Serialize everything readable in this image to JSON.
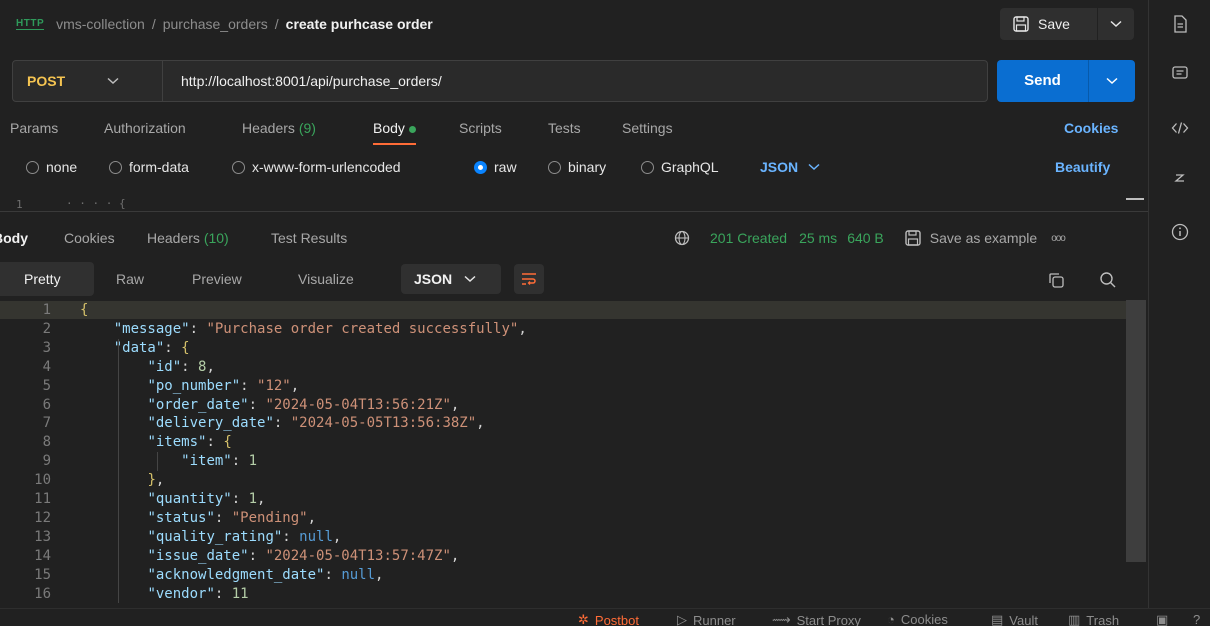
{
  "breadcrumb": {
    "badge": "HTTP",
    "collection": "vms-collection",
    "folder": "purchase_orders",
    "request": "create purhcase order",
    "sep": "/"
  },
  "save": {
    "label": "Save"
  },
  "request": {
    "method": "POST",
    "url": "http://localhost:8001/api/purchase_orders/",
    "send_label": "Send"
  },
  "req_tabs": [
    {
      "label": "Params"
    },
    {
      "label": "Authorization"
    },
    {
      "label": "Headers",
      "count": "(9)"
    },
    {
      "label": "Body",
      "active": true
    },
    {
      "label": "Scripts"
    },
    {
      "label": "Tests"
    },
    {
      "label": "Settings"
    }
  ],
  "cookies_link": "Cookies",
  "body_types": [
    "none",
    "form-data",
    "x-www-form-urlencoded",
    "raw",
    "binary",
    "GraphQL"
  ],
  "body_type_selected": "raw",
  "body_lang": "JSON",
  "beautify_label": "Beautify",
  "req_editor": {
    "line": "1",
    "text": "· · · · {"
  },
  "resp_tabs": [
    {
      "label": "Body",
      "active": true
    },
    {
      "label": "Cookies"
    },
    {
      "label": "Headers",
      "count": "(10)"
    },
    {
      "label": "Test Results"
    }
  ],
  "resp_meta": {
    "status": "201 Created",
    "time": "25 ms",
    "size": "640 B",
    "save_example": "Save as example",
    "more": "ooo"
  },
  "view_tabs": [
    "Pretty",
    "Raw",
    "Preview",
    "Visualize"
  ],
  "view_active": "Pretty",
  "resp_lang": "JSON",
  "code_lines": [
    "{",
    "    \"message\": \"Purchase order created successfully\",",
    "    \"data\": {",
    "        \"id\": 8,",
    "        \"po_number\": \"12\",",
    "        \"order_date\": \"2024-05-04T13:56:21Z\",",
    "        \"delivery_date\": \"2024-05-05T13:56:38Z\",",
    "        \"items\": {",
    "            \"item\": 1",
    "        },",
    "        \"quantity\": 1,",
    "        \"status\": \"Pending\",",
    "        \"quality_rating\": null,",
    "        \"issue_date\": \"2024-05-04T13:57:47Z\",",
    "        \"acknowledgment_date\": null,",
    "        \"vendor\": 11"
  ],
  "status_bar": [
    "Postbot",
    "Runner",
    "Start Proxy",
    "Cookies",
    "Vault",
    "Trash"
  ],
  "colors": {
    "accent": "#ff6c37",
    "send": "#0a6ed1",
    "link": "#6ab4ff",
    "success": "#3aa55c",
    "method": "#f5c451"
  }
}
